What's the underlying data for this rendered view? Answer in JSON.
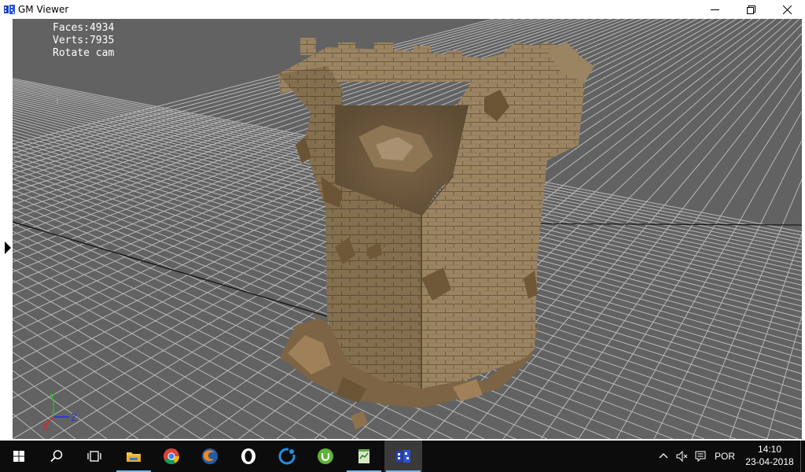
{
  "window": {
    "title": "GM Viewer",
    "icon": "gm-viewer-icon",
    "controls": {
      "minimize": "minimize-icon",
      "maximize": "restore-icon",
      "close": "close-icon"
    }
  },
  "viewport": {
    "hud": {
      "faces": "Faces:4934",
      "verts": "Verts:7935",
      "mode": "Rotate cam",
      "mark": "!"
    },
    "axes": {
      "y": "Y",
      "z": "Z",
      "x": "X"
    },
    "colors": {
      "background": "#626262",
      "grid": "#c8c8c8",
      "stone": "#9c8663",
      "axis_y": "#22c022",
      "axis_z": "#2233dd",
      "axis_x": "#dd2222"
    }
  },
  "taskbar": {
    "apps": [
      {
        "name": "start",
        "icon": "windows-logo-icon"
      },
      {
        "name": "search",
        "icon": "search-icon"
      },
      {
        "name": "task-view",
        "icon": "task-view-icon"
      },
      {
        "name": "file-explorer",
        "icon": "folder-icon"
      },
      {
        "name": "chrome",
        "icon": "chrome-icon"
      },
      {
        "name": "firefox",
        "icon": "firefox-icon"
      },
      {
        "name": "opera",
        "icon": "opera-icon"
      },
      {
        "name": "ccleaner",
        "icon": "ccleaner-icon"
      },
      {
        "name": "utorrent",
        "icon": "utorrent-icon"
      },
      {
        "name": "notepad-plus",
        "icon": "notepad-icon"
      },
      {
        "name": "gm-viewer",
        "icon": "gm-viewer-icon"
      }
    ],
    "tray": {
      "language": "POR",
      "time": "14:10",
      "date": "23-04-2018"
    }
  }
}
